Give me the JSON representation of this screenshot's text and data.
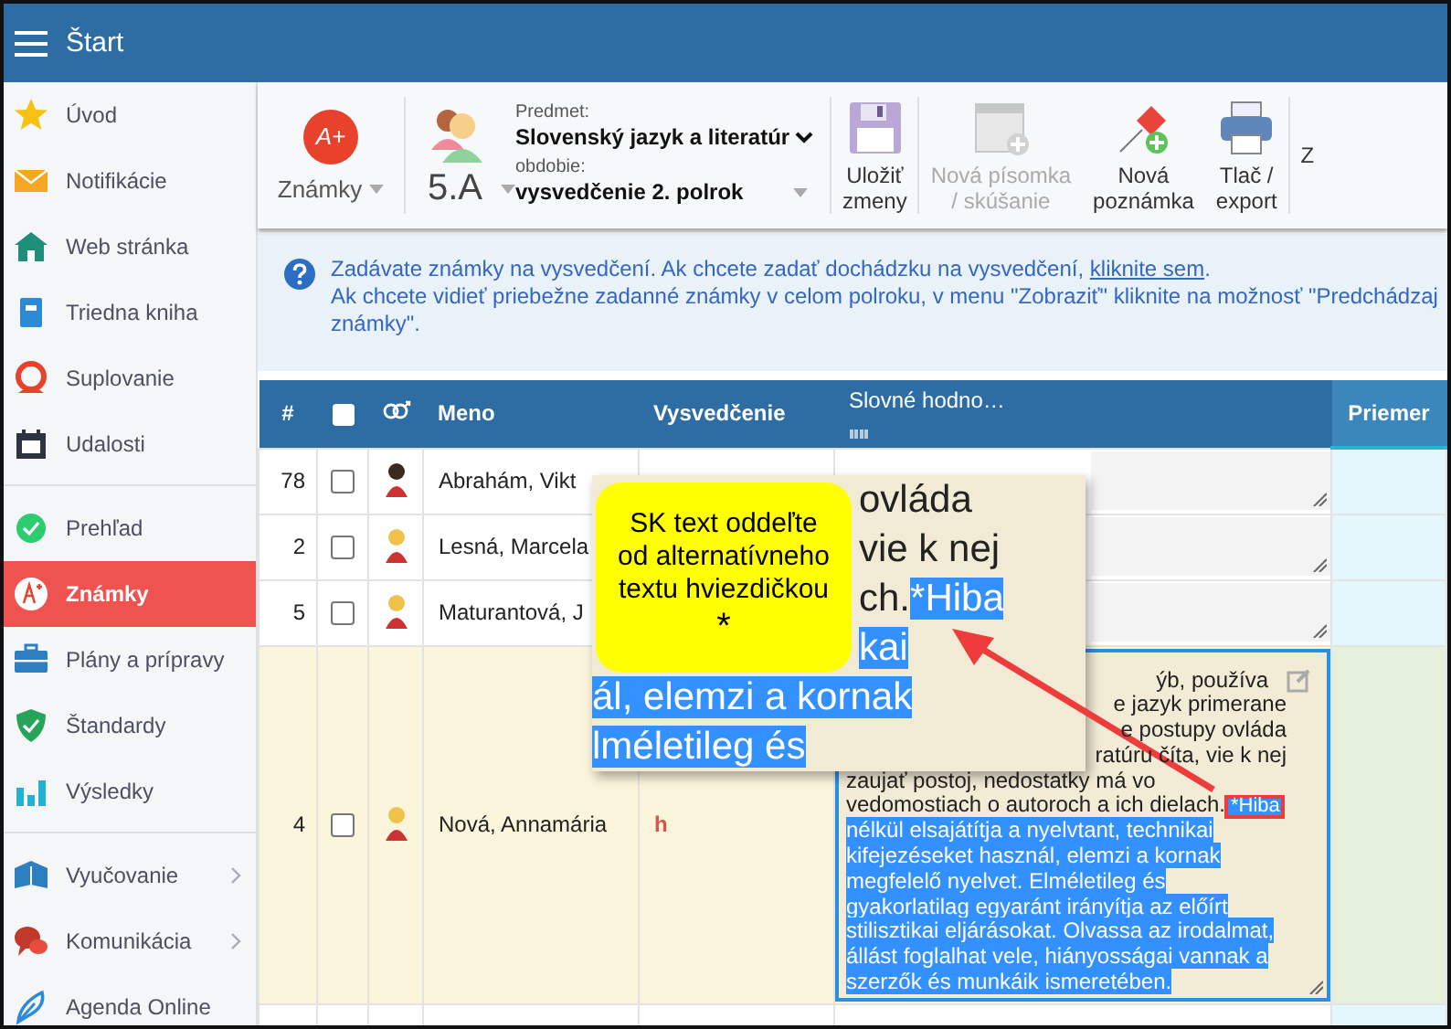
{
  "top_bar": {
    "title": "Štart"
  },
  "sidebar": {
    "sections": [
      {
        "items": [
          {
            "label": "Úvod",
            "selected": false,
            "expandable": false
          },
          {
            "label": "Notifikácie",
            "selected": false,
            "expandable": false
          },
          {
            "label": "Web stránka",
            "selected": false,
            "expandable": false
          },
          {
            "label": "Triedna kniha",
            "selected": false,
            "expandable": false
          },
          {
            "label": "Suplovanie",
            "selected": false,
            "expandable": false
          },
          {
            "label": "Udalosti",
            "selected": false,
            "expandable": false
          }
        ]
      },
      {
        "items": [
          {
            "label": "Prehľad",
            "selected": false,
            "expandable": false
          },
          {
            "label": "Známky",
            "selected": true,
            "expandable": false
          },
          {
            "label": "Plány a prípravy",
            "selected": false,
            "expandable": false
          },
          {
            "label": "Štandardy",
            "selected": false,
            "expandable": false
          },
          {
            "label": "Výsledky",
            "selected": false,
            "expandable": false
          }
        ]
      },
      {
        "items": [
          {
            "label": "Vyučovanie",
            "selected": false,
            "expandable": true
          },
          {
            "label": "Komunikácia",
            "selected": false,
            "expandable": true
          },
          {
            "label": "Agenda Online",
            "selected": false,
            "expandable": false
          }
        ]
      }
    ]
  },
  "toolbar": {
    "grades": {
      "icon_text": "A+",
      "label": "Známky"
    },
    "class": {
      "label": "5.A"
    },
    "subject": {
      "label": "Predmet:",
      "value": "Slovenský jazyk a literatúr"
    },
    "period": {
      "label": "obdobie:",
      "value": "vysvedčenie 2. polrok"
    },
    "buttons": [
      {
        "lines": [
          "Uložiť",
          "zmeny"
        ],
        "disabled": false
      },
      {
        "lines": [
          "Nová písomka",
          "/ skúšanie"
        ],
        "disabled": true
      },
      {
        "lines": [
          "Nová",
          "poznámka"
        ],
        "disabled": false
      },
      {
        "lines": [
          "Tlač /",
          "export"
        ],
        "disabled": false
      },
      {
        "lines": [
          "Z"
        ],
        "disabled": false
      }
    ]
  },
  "info": {
    "text": "Zadávate známky na vysvedčení. Ak chcete zadať dochádzku na vysvedčení, ",
    "link": "kliknite sem",
    "after_link": ".",
    "lines": [
      "Ak chcete vidieť priebežne zadanné známky v celom polroku, v menu \"Zobraziť\" kliknite na možnosť \"Predchádzaj",
      "známky\"."
    ]
  },
  "table": {
    "header": {
      "number": "#",
      "select_all_checked": false,
      "name": "Meno",
      "report": "Vysvedčenie",
      "verbal": "Slovné hodno…",
      "average": "Priemer"
    },
    "rows": [
      {
        "number": "78",
        "checked": false,
        "male": true,
        "name": "Abrahám, Vikt"
      },
      {
        "number": "2",
        "checked": false,
        "male": false,
        "name": "Lesná, Marcela"
      },
      {
        "number": "5",
        "checked": false,
        "male": false,
        "name": "Maturantová, J"
      },
      {
        "number": "4",
        "checked": false,
        "male": false,
        "name": "Nová, Annamária",
        "grade": "h",
        "note": {
          "focused": true,
          "lines": [
            {
              "kind": "partial",
              "parts": [
                {
                  "text": "ýb, používa",
                  "selected": false
                }
              ]
            },
            {
              "kind": "partial",
              "parts": [
                {
                  "text": "e jazyk primerane",
                  "selected": false
                }
              ]
            },
            {
              "kind": "partial",
              "parts": [
                {
                  "text": "e postupy ovláda",
                  "selected": false
                }
              ]
            },
            {
              "kind": "partial",
              "parts": [
                {
                  "text": "ratúru číta, vie k nej",
                  "selected": false
                }
              ]
            },
            {
              "kind": "full",
              "parts": [
                {
                  "text": "zaujať postoj, nedostatky má vo",
                  "selected": false
                }
              ]
            },
            {
              "kind": "full",
              "parts": [
                {
                  "text": "vedomostiach o autoroch a ich dielach.",
                  "selected": false
                },
                {
                  "text": "*Hiba",
                  "selected": true,
                  "marked": true
                }
              ]
            },
            {
              "kind": "full",
              "parts": [
                {
                  "text": "nélkül elsajátítja a nyelvtant, technikai",
                  "selected": true
                }
              ]
            },
            {
              "kind": "full",
              "parts": [
                {
                  "text": "kifejezéseket használ, elemzi a kornak",
                  "selected": true
                }
              ]
            },
            {
              "kind": "full",
              "parts": [
                {
                  "text": "megfelelő nyelvet. Elméletileg és",
                  "selected": true
                }
              ]
            },
            {
              "kind": "full",
              "parts": [
                {
                  "text": "gyakorlatilag egyaránt irányítja az előírt",
                  "selected": true
                }
              ]
            },
            {
              "kind": "full",
              "parts": [
                {
                  "text": "stilisztikai eljárásokat. Olvassa az irodalmat,",
                  "selected": true
                }
              ]
            },
            {
              "kind": "full",
              "parts": [
                {
                  "text": "állást foglalhat vele, hiányosságai vannak a",
                  "selected": true
                }
              ]
            },
            {
              "kind": "full",
              "parts": [
                {
                  "text": "szerzők és munkáik ismeretében.",
                  "selected": true
                }
              ]
            }
          ]
        }
      }
    ]
  },
  "magnifier": {
    "lines": [
      {
        "kind": "inset",
        "parts": [
          {
            "text": "ovláda",
            "selected": false
          }
        ]
      },
      {
        "kind": "inset",
        "parts": [
          {
            "text": "vie k nej",
            "selected": false
          }
        ]
      },
      {
        "kind": "inset",
        "parts": [
          {
            "text": "ch.",
            "selected": false
          },
          {
            "text": "*Hiba",
            "selected": true
          }
        ]
      },
      {
        "kind": "inset",
        "parts": [
          {
            "text": "kai",
            "selected": true
          }
        ]
      },
      {
        "kind": "flush",
        "parts": [
          {
            "text": "ál, elemzi a kornak",
            "selected": true
          }
        ]
      },
      {
        "kind": "flush",
        "parts": [
          {
            "text": "lméletileg és",
            "selected": true
          }
        ]
      }
    ]
  },
  "callout": {
    "lines": [
      "SK text oddeľte",
      "od alternatívneho",
      "textu hviezdičkou"
    ],
    "mark": "*"
  }
}
